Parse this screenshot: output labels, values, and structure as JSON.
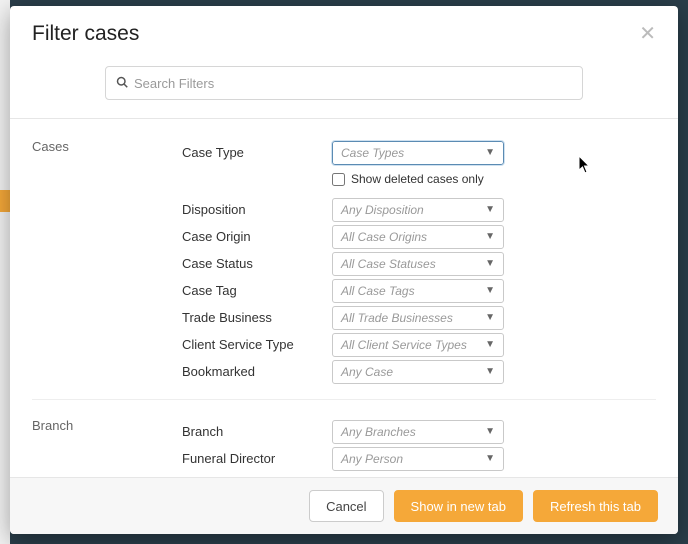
{
  "modal": {
    "title": "Filter cases",
    "search_placeholder": "Search Filters"
  },
  "sections": {
    "cases": {
      "title": "Cases",
      "case_type": {
        "label": "Case Type",
        "placeholder": "Case Types"
      },
      "show_deleted": "Show deleted cases only",
      "disposition": {
        "label": "Disposition",
        "placeholder": "Any Disposition"
      },
      "case_origin": {
        "label": "Case Origin",
        "placeholder": "All Case Origins"
      },
      "case_status": {
        "label": "Case Status",
        "placeholder": "All Case Statuses"
      },
      "case_tag": {
        "label": "Case Tag",
        "placeholder": "All Case Tags"
      },
      "trade_business": {
        "label": "Trade Business",
        "placeholder": "All Trade Businesses"
      },
      "client_service_type": {
        "label": "Client Service Type",
        "placeholder": "All Client Service Types"
      },
      "bookmarked": {
        "label": "Bookmarked",
        "placeholder": "Any Case"
      }
    },
    "branch": {
      "title": "Branch",
      "branch": {
        "label": "Branch",
        "placeholder": "Any Branches"
      },
      "funeral_director": {
        "label": "Funeral Director",
        "placeholder": "Any Person"
      }
    }
  },
  "footer": {
    "cancel": "Cancel",
    "show_new_tab": "Show in new tab",
    "refresh": "Refresh this tab"
  }
}
